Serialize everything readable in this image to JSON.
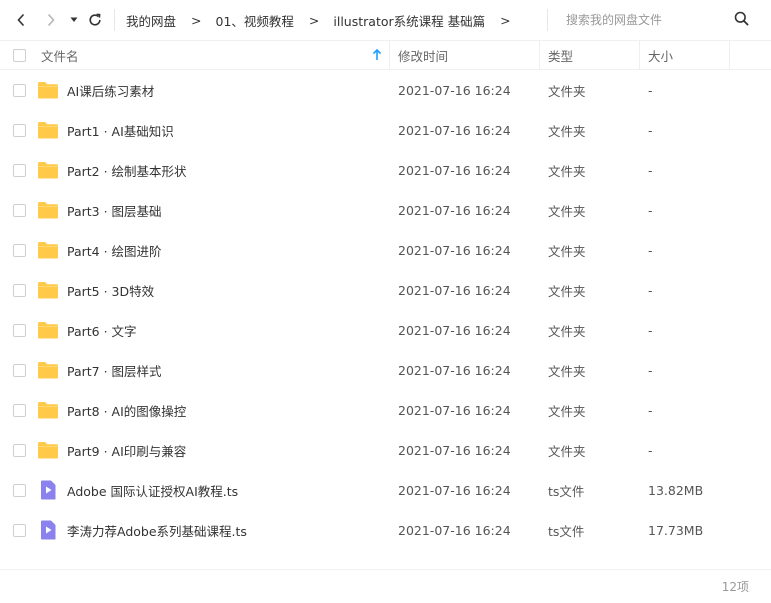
{
  "breadcrumb": {
    "items": [
      "我的网盘",
      "01、视频教程",
      "illustrator系统课程 基础篇"
    ],
    "separator": ">"
  },
  "search": {
    "placeholder": "搜索我的网盘文件"
  },
  "columns": {
    "name": "文件名",
    "modified": "修改时间",
    "type": "类型",
    "size": "大小"
  },
  "colors": {
    "folder": "#ffc94a",
    "video": "#8c82ee",
    "sort_arrow": "#1e9fff"
  },
  "files": [
    {
      "name": "AI课后练习素材",
      "modified": "2021-07-16 16:24",
      "type": "文件夹",
      "size": "-",
      "icon": "folder-icon"
    },
    {
      "name": "Part1 · AI基础知识",
      "modified": "2021-07-16 16:24",
      "type": "文件夹",
      "size": "-",
      "icon": "folder-icon"
    },
    {
      "name": "Part2 · 绘制基本形状",
      "modified": "2021-07-16 16:24",
      "type": "文件夹",
      "size": "-",
      "icon": "folder-icon"
    },
    {
      "name": "Part3 · 图层基础",
      "modified": "2021-07-16 16:24",
      "type": "文件夹",
      "size": "-",
      "icon": "folder-icon"
    },
    {
      "name": "Part4 · 绘图进阶",
      "modified": "2021-07-16 16:24",
      "type": "文件夹",
      "size": "-",
      "icon": "folder-icon"
    },
    {
      "name": "Part5 · 3D特效",
      "modified": "2021-07-16 16:24",
      "type": "文件夹",
      "size": "-",
      "icon": "folder-icon"
    },
    {
      "name": "Part6 · 文字",
      "modified": "2021-07-16 16:24",
      "type": "文件夹",
      "size": "-",
      "icon": "folder-icon"
    },
    {
      "name": "Part7 · 图层样式",
      "modified": "2021-07-16 16:24",
      "type": "文件夹",
      "size": "-",
      "icon": "folder-icon"
    },
    {
      "name": "Part8 · AI的图像操控",
      "modified": "2021-07-16 16:24",
      "type": "文件夹",
      "size": "-",
      "icon": "folder-icon"
    },
    {
      "name": "Part9 · AI印刷与兼容",
      "modified": "2021-07-16 16:24",
      "type": "文件夹",
      "size": "-",
      "icon": "folder-icon"
    },
    {
      "name": "Adobe 国际认证授权AI教程.ts",
      "modified": "2021-07-16 16:24",
      "type": "ts文件",
      "size": "13.82MB",
      "icon": "video-file-icon"
    },
    {
      "name": "李涛力荐Adobe系列基础课程.ts",
      "modified": "2021-07-16 16:24",
      "type": "ts文件",
      "size": "17.73MB",
      "icon": "video-file-icon"
    }
  ],
  "footer": {
    "count": "12项"
  }
}
